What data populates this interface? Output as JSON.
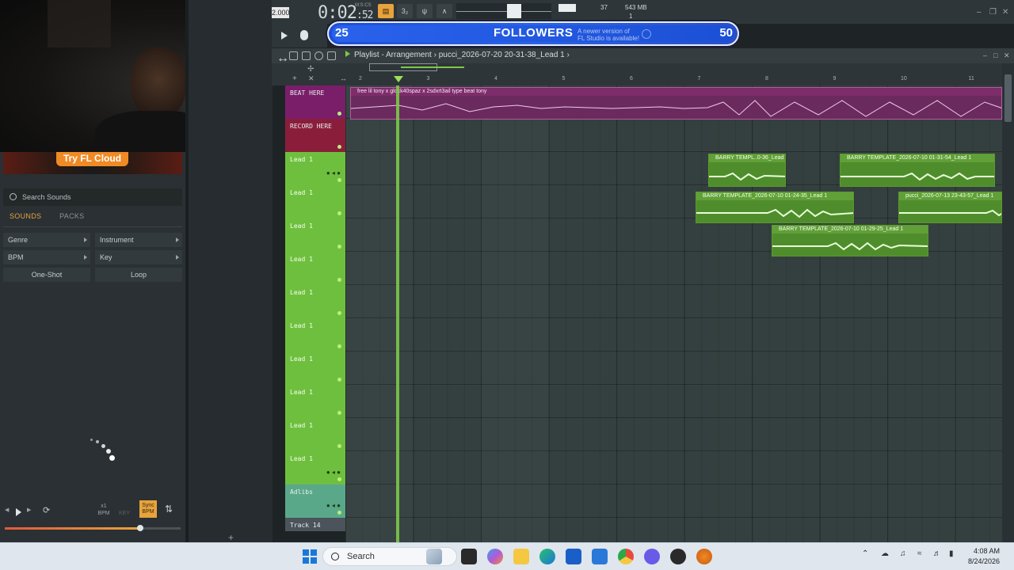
{
  "webcam_promo": {
    "button": "Try FL Cloud"
  },
  "browser": {
    "search_placeholder": "Search Sounds",
    "tabs": [
      "SOUNDS",
      "PACKS"
    ],
    "filters": {
      "genre": "Genre",
      "instrument": "Instrument",
      "bpm": "BPM",
      "key": "Key",
      "one_shot": "One-Shot",
      "loop": "Loop"
    },
    "transport": {
      "mult": "x1",
      "bpm_label": "BPM",
      "key_label": "KEY",
      "sync": "Sync",
      "sync_bpm": "BPM"
    },
    "volume_fraction": 0.77
  },
  "fl_top": {
    "tempo": "2.000",
    "time_label": "M:S:CS",
    "time": "0:02",
    "time_cs": "52",
    "pattern": "3₂",
    "cpu": "37",
    "memory": "543 MB",
    "mem_sub": "1"
  },
  "followers": {
    "start": "25",
    "label": "FOLLOWERS",
    "goal": "50",
    "notice_line1": "A newer version of",
    "notice_line2": "FL Studio is available!"
  },
  "playlist": {
    "title": "Playlist - Arrangement",
    "sep": "›",
    "pattern": "pucci_2026-07-20 20-31-38_Lead 1",
    "ruler": [
      "2",
      "3",
      "4",
      "5",
      "6",
      "7",
      "8",
      "9",
      "10",
      "11"
    ]
  },
  "tracks": [
    {
      "name": "BEAT HERE",
      "type": "beat"
    },
    {
      "name": "RECORD HERE",
      "type": "record"
    },
    {
      "name": "Lead 1",
      "type": "lead-head"
    },
    {
      "name": "Lead 1",
      "type": "lead"
    },
    {
      "name": "Lead 1",
      "type": "lead"
    },
    {
      "name": "Lead 1",
      "type": "lead"
    },
    {
      "name": "Lead 1",
      "type": "lead"
    },
    {
      "name": "Lead 1",
      "type": "lead"
    },
    {
      "name": "Lead 1",
      "type": "lead"
    },
    {
      "name": "Lead 1",
      "type": "lead"
    },
    {
      "name": "Lead 1",
      "type": "lead"
    },
    {
      "name": "Lead 1",
      "type": "lead-head"
    },
    {
      "name": "Adlibs",
      "type": "adlibs"
    },
    {
      "name": "Track 14",
      "type": "track14"
    }
  ],
  "clips": {
    "beat": "free lil tony x glokk40spaz x 2sdxrt3ail type beat tony",
    "c1": "BARRY TEMPL..0-36_Lead 1",
    "c2": "BARRY TEMPLATE_2026-07-10 01-31-54_Lead 1",
    "c3": "BARRY TEMPLATE_2026-07-10 01-24-35_Lead 1",
    "c4": "pucci_2026-07-13 23-43-57_Lead 1",
    "c5": "BARRY TEMPLATE_2026-07-10 01-29-25_Lead 1"
  },
  "taskbar": {
    "search": "Search",
    "time": "4:08 AM",
    "date": "8/24/2026"
  },
  "colors": {
    "accent": "#e8a33c",
    "lead_green": "#6fbf3f",
    "beat_purple": "#7a1e6a",
    "followers_blue": "#1d4fd8"
  }
}
